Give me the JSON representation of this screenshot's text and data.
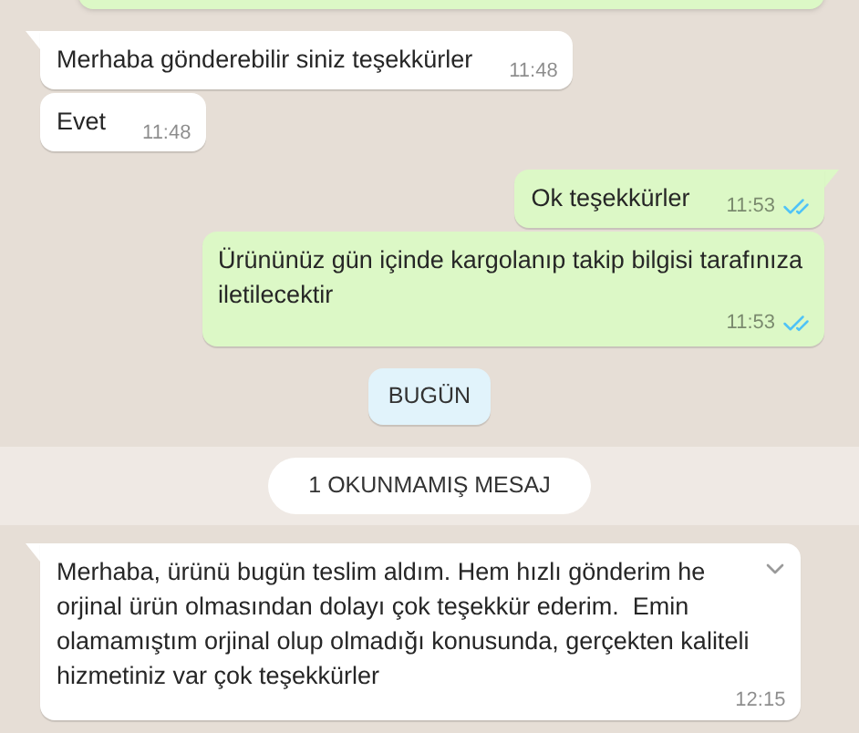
{
  "messages": [
    {
      "kind": "bubble",
      "outgoing": true,
      "cut_off": true
    },
    {
      "kind": "bubble",
      "outgoing": false,
      "tail": true,
      "text": "Merhaba gönderebilir siniz teşekkürler",
      "time": "11:48"
    },
    {
      "kind": "bubble",
      "outgoing": false,
      "tail": false,
      "text": "Evet",
      "time": "11:48"
    },
    {
      "kind": "bubble",
      "outgoing": true,
      "tail": true,
      "text": "Ok teşekkürler",
      "time": "11:53",
      "read": true
    },
    {
      "kind": "bubble",
      "outgoing": true,
      "tail": false,
      "text": "Ürününüz gün içinde kargolanıp takip bilgisi tarafınıza\niletilecektir",
      "time": "11:53",
      "read": true
    },
    {
      "kind": "date",
      "text": "BUGÜN"
    },
    {
      "kind": "unread",
      "text": "1 OKUNMAMIŞ MESAJ"
    },
    {
      "kind": "bubble",
      "outgoing": false,
      "tail": true,
      "hovered": true,
      "text": "Merhaba, ürünü bugün teslim aldım. Hem hızlı gönderim he\norjinal ürün olmasından dolayı çok teşekkür ederim.  Emin\nolamamıştım orjinal olup olmadığı konusunda, gerçekten kaliteli\nhizmetiniz var çok teşekkürler",
      "time": "12:15"
    }
  ]
}
